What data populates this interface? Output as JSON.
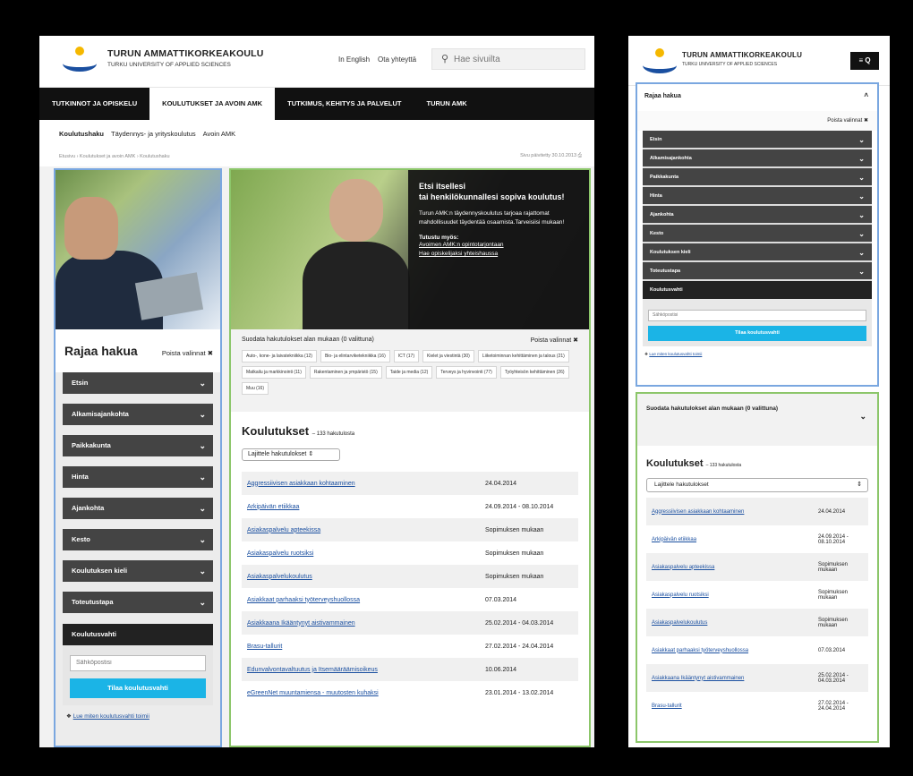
{
  "brand": {
    "name": "TURUN AMMATTIKORKEAKOULU",
    "sub": "TURKU UNIVERSITY OF APPLIED SCIENCES"
  },
  "header": {
    "english": "In English",
    "contact": "Ota yhteyttä",
    "search_placeholder": "Hae sivuilta"
  },
  "nav": [
    "TUTKINNOT JA OPISKELU",
    "KOULUTUKSET JA AVOIN AMK",
    "TUTKIMUS, KEHITYS JA PALVELUT",
    "TURUN AMK"
  ],
  "subnav": [
    "Koulutushaku",
    "Täydennys- ja yrityskoulutus",
    "Avoin AMK"
  ],
  "breadcrumb": {
    "path": "Etusivu › Koulutukset ja avoin AMK › Koulutushaku",
    "updated": "Sivu päivitetty 30.10.2013"
  },
  "filter": {
    "title": "Rajaa hakua",
    "clear": "Poista valinnat",
    "items": [
      "Etsin",
      "Alkamisajankohta",
      "Paikkakunta",
      "Hinta",
      "Ajankohta",
      "Kesto",
      "Koulutuksen kieli",
      "Toteutustapa"
    ],
    "watch": "Koulutusvahti",
    "email_placeholder": "Sähköpostisi",
    "order_button": "Tilaa koulutusvahti",
    "info_link": "Lue miten koulutusvahti toimii"
  },
  "hero": {
    "title1": "Etsi itsellesi",
    "title2": "tai henkilökunnallesi sopiva koulutus!",
    "text": "Turun AMK:n täydennyskoulutus tarjoaa rajattomat mahdollisuudet täydentää osaamista.Tarveisiisi mukaan!",
    "also": "Tutustu myös:",
    "link1": "Avoimen AMK:n opintotarjontaan",
    "link2": "Hae opiskelijaksi yhteishaussa"
  },
  "categories": {
    "title": "Suodata hakutulokset alan mukaan (0 valittuna)",
    "clear": "Poista valinnat",
    "chips": [
      "Auto-, kone- ja laivatekniikka (12)",
      "Bio- ja elintarviketekniikka (16)",
      "ICT (17)",
      "Kielet ja viestintä (30)",
      "Liiketoiminnan kehittäminen ja talous (21)",
      "Matkailu ja markkinointi (11)",
      "Rakentaminen ja ympäristö (15)",
      "Taide ja media (12)",
      "Terveys ja hyvinvointi (77)",
      "Työyhteisön kehittäminen (26)",
      "Muu (16)"
    ]
  },
  "results": {
    "title": "Koulutukset",
    "count": "– 133 hakutulosta",
    "sort": "Lajittele hakutulokset",
    "rows": [
      {
        "name": "Aggressiivisen asiakkaan kohtaaminen",
        "date": "24.04.2014"
      },
      {
        "name": "Arkipäivän etiikkaa",
        "date": "24.09.2014 - 08.10.2014"
      },
      {
        "name": "Asiakaspalvelu apteekissa",
        "date": "Sopimuksen mukaan"
      },
      {
        "name": "Asiakaspalvelu ruotsiksi",
        "date": "Sopimuksen mukaan"
      },
      {
        "name": "Asiakaspalvelukoulutus",
        "date": "Sopimuksen mukaan"
      },
      {
        "name": "Asiakkaat parhaaksi työterveyshuollossa",
        "date": "07.03.2014"
      },
      {
        "name": "Asiakkaana Ikääntynyt aistivammainen",
        "date": "25.02.2014 - 04.03.2014"
      },
      {
        "name": "Brasu-tallurit",
        "date": "27.02.2014 - 24.04.2014"
      },
      {
        "name": "Edunvalvontavaltuutus ja Itsemääräämisoikeus",
        "date": "10.06.2014"
      },
      {
        "name": "eGreenNet muuntamiensa - muutosten kuhaksi",
        "date": "23.01.2014 - 13.02.2014"
      }
    ]
  },
  "mobile": {
    "menu": "≡ Q",
    "rows": [
      {
        "name": "Aggressiivisen asiakkaan kohtaaminen",
        "date": "24.04.2014"
      },
      {
        "name": "Arkipäivän etiikkaa",
        "date": "24.09.2014 - 08.10.2014"
      },
      {
        "name": "Asiakaspalvelu apteekissa",
        "date": "Sopimuksen mukaan"
      },
      {
        "name": "Asiakaspalvelu ruotsiksi",
        "date": "Sopimuksen mukaan"
      },
      {
        "name": "Asiakaspalvelukoulutus",
        "date": "Sopimuksen mukaan"
      },
      {
        "name": "Asiakkaat parhaaksi työterveyshuollossa",
        "date": "07.03.2014"
      },
      {
        "name": "Asiakkaana Ikääntynyt aistivammainen",
        "date": "25.02.2014 - 04.03.2014"
      },
      {
        "name": "Brasu-tallurit",
        "date": "27.02.2014 - 24.04.2014"
      }
    ]
  },
  "colors": {
    "accent": "#1bb4e6",
    "blue_frame": "#7aa7e0",
    "green_frame": "#8cc66a",
    "nav": "#111111"
  }
}
